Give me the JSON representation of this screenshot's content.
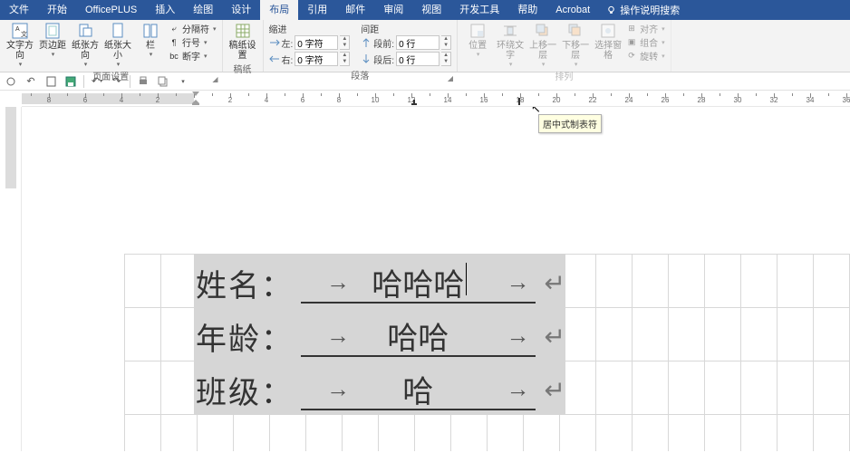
{
  "tabs": {
    "file": "文件",
    "home": "开始",
    "officeplus": "OfficePLUS",
    "insert": "插入",
    "draw": "绘图",
    "design": "设计",
    "layout": "布局",
    "references": "引用",
    "mailings": "邮件",
    "review": "审阅",
    "view": "视图",
    "devtools": "开发工具",
    "help": "帮助",
    "acrobat": "Acrobat"
  },
  "search_placeholder": "操作说明搜索",
  "ribbon": {
    "page_setup": {
      "text_dir": "文字方向",
      "margins": "页边距",
      "orientation": "纸张方向",
      "size": "纸张大小",
      "columns": "栏",
      "breaks": "分隔符",
      "line_numbers": "行号",
      "hyphenation": "断字",
      "label": "页面设置"
    },
    "manuscript": {
      "settings": "稿纸设置",
      "label": "稿纸"
    },
    "paragraph": {
      "indent_title": "缩进",
      "spacing_title": "间距",
      "left_label": "左:",
      "left_val": "0 字符",
      "right_label": "右:",
      "right_val": "0 字符",
      "before_label": "段前:",
      "before_val": "0 行",
      "after_label": "段后:",
      "after_val": "0 行",
      "label": "段落"
    },
    "arrange": {
      "position": "位置",
      "wrap": "环绕文字",
      "forward": "上移一层",
      "backward": "下移一层",
      "selection_pane": "选择窗格",
      "align": "对齐",
      "group": "组合",
      "rotate": "旋转",
      "label": "排列"
    }
  },
  "tooltip": "居中式制表符",
  "document": {
    "lines": [
      {
        "label": "姓名：",
        "value": "哈哈哈"
      },
      {
        "label": "年龄：",
        "value": "哈哈"
      },
      {
        "label": "班级：",
        "value": "哈"
      }
    ]
  },
  "ruler_numbers": [
    2,
    4,
    6,
    8,
    10,
    12,
    14,
    16,
    18,
    2,
    4,
    6,
    8,
    10,
    12,
    14,
    16,
    18
  ]
}
